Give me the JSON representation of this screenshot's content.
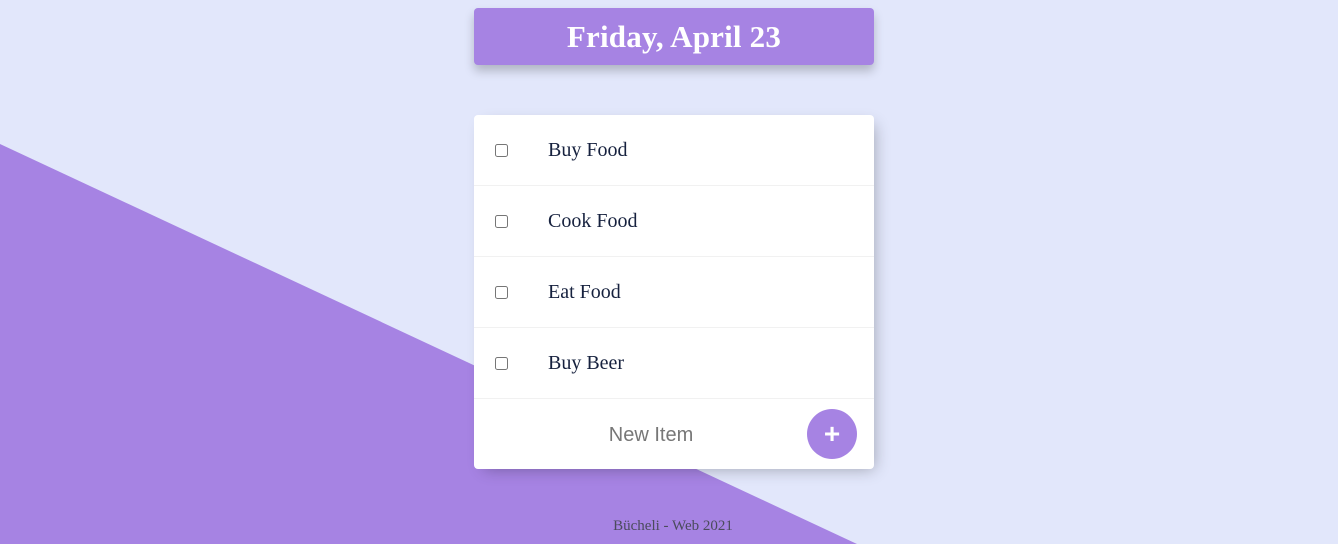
{
  "colors": {
    "background": "#e2e7fb",
    "accent": "#a683e3",
    "card": "#ffffff",
    "item_text": "#16213e"
  },
  "header": {
    "date": "Friday, April 23"
  },
  "todo": {
    "items": [
      {
        "label": "Buy Food",
        "checked": false
      },
      {
        "label": "Cook Food",
        "checked": false
      },
      {
        "label": "Eat Food",
        "checked": false
      },
      {
        "label": "Buy Beer",
        "checked": false
      }
    ],
    "new_item_placeholder": "New Item",
    "add_button_label": "+",
    "add_button_icon": "plus-icon"
  },
  "footer": {
    "text": "Bücheli - Web 2021"
  }
}
